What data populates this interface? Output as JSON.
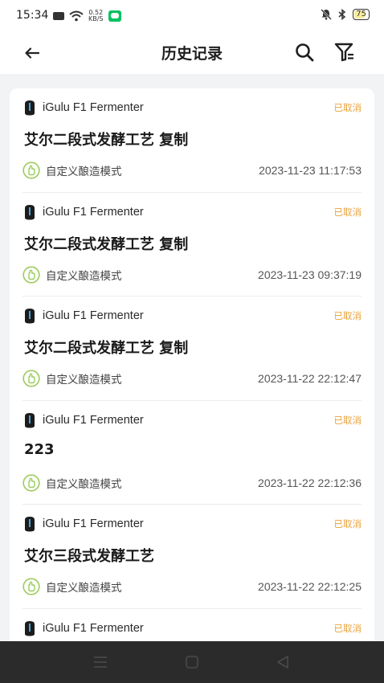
{
  "status_bar": {
    "time": "15:34",
    "net_speed_value": "0.52",
    "net_speed_unit": "KB/S",
    "battery": "75"
  },
  "header": {
    "title": "历史记录"
  },
  "colors": {
    "status_cancelled": "#e8a33c",
    "mode_icon": "#9ccc5c",
    "nav_bar": "#2b2b2b"
  },
  "records": [
    {
      "device": "iGulu F1 Fermenter",
      "status": "已取消",
      "title": "艾尔二段式发酵工艺 复制",
      "mode": "自定义酿造模式",
      "time": "2023-11-23 11:17:53"
    },
    {
      "device": "iGulu F1 Fermenter",
      "status": "已取消",
      "title": "艾尔二段式发酵工艺 复制",
      "mode": "自定义酿造模式",
      "time": "2023-11-23 09:37:19"
    },
    {
      "device": "iGulu F1 Fermenter",
      "status": "已取消",
      "title": "艾尔二段式发酵工艺 复制",
      "mode": "自定义酿造模式",
      "time": "2023-11-22 22:12:47"
    },
    {
      "device": "iGulu F1 Fermenter",
      "status": "已取消",
      "title": "223",
      "mode": "自定义酿造模式",
      "time": "2023-11-22 22:12:36"
    },
    {
      "device": "iGulu F1 Fermenter",
      "status": "已取消",
      "title": "艾尔三段式发酵工艺",
      "mode": "自定义酿造模式",
      "time": "2023-11-22 22:12:25"
    },
    {
      "device": "iGulu F1 Fermenter",
      "status": "已取消"
    }
  ]
}
